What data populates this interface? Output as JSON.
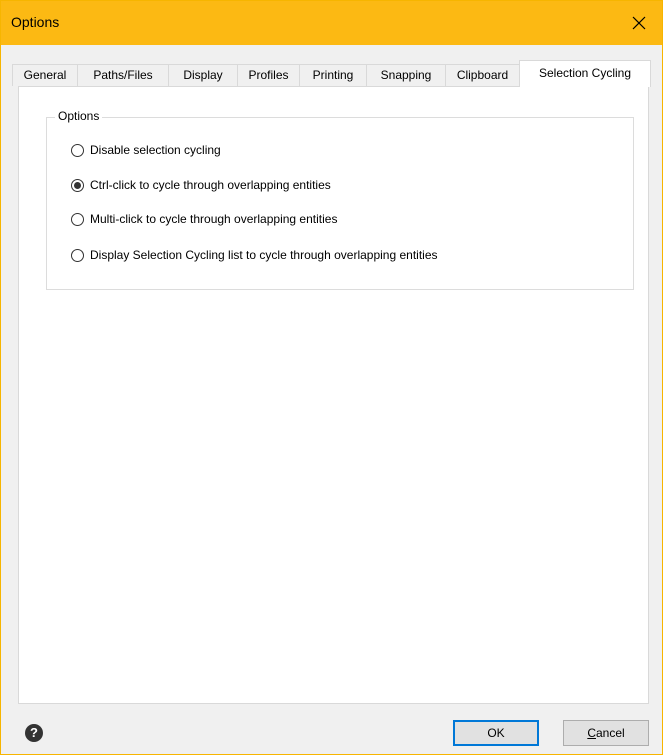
{
  "window": {
    "title": "Options",
    "accent_color": "#fcb913",
    "close_icon": "close-icon"
  },
  "tabs": [
    {
      "label": "General",
      "active": false
    },
    {
      "label": "Paths/Files",
      "active": false
    },
    {
      "label": "Display",
      "active": false
    },
    {
      "label": "Profiles",
      "active": false
    },
    {
      "label": "Printing",
      "active": false
    },
    {
      "label": "Snapping",
      "active": false
    },
    {
      "label": "Clipboard",
      "active": false
    },
    {
      "label": "Selection Cycling",
      "active": true
    }
  ],
  "options_group": {
    "legend": "Options",
    "radios": [
      {
        "label": "Disable selection cycling",
        "checked": false
      },
      {
        "label": "Ctrl-click to cycle through overlapping entities",
        "checked": true
      },
      {
        "label": "Multi-click to cycle through overlapping entities",
        "checked": false
      },
      {
        "label": "Display Selection Cycling list to cycle through overlapping entities",
        "checked": false
      }
    ]
  },
  "footer": {
    "help_icon": "question-circle-icon",
    "ok_label": "OK",
    "cancel_label": "Cancel",
    "default_button_color": "#0078d7"
  }
}
